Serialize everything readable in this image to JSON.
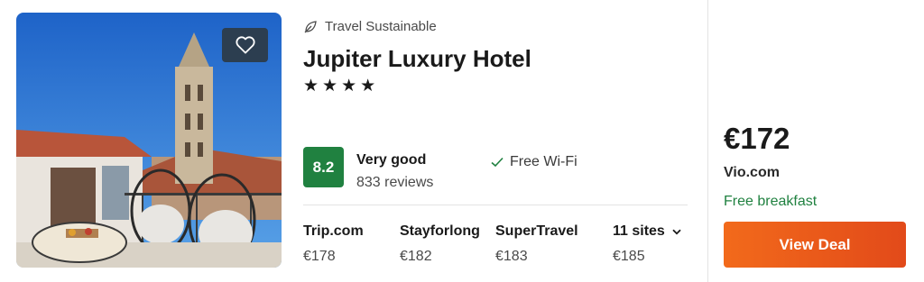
{
  "hotel": {
    "sustainability_label": "Travel Sustainable",
    "name": "Jupiter Luxury Hotel",
    "stars": "★★★★",
    "score": "8.2",
    "rating_text": "Very good",
    "reviews": "833 reviews",
    "amenity": "Free Wi-Fi"
  },
  "providers": [
    {
      "name": "Trip.com",
      "price": "€178"
    },
    {
      "name": "Stayforlong",
      "price": "€182"
    },
    {
      "name": "SuperTravel",
      "price": "€183"
    },
    {
      "name": "11 sites",
      "price": "€185"
    }
  ],
  "deal": {
    "price": "€172",
    "site": "Vio.com",
    "perk": "Free breakfast",
    "button_label": "View Deal"
  },
  "colors": {
    "score_bg": "#208140",
    "deal_button": "#f0621a",
    "perk_text": "#208140",
    "favorite_bg": "#2c3e50"
  },
  "icons": [
    "leaf-icon",
    "heart-icon",
    "check-icon",
    "chevron-down-icon"
  ]
}
